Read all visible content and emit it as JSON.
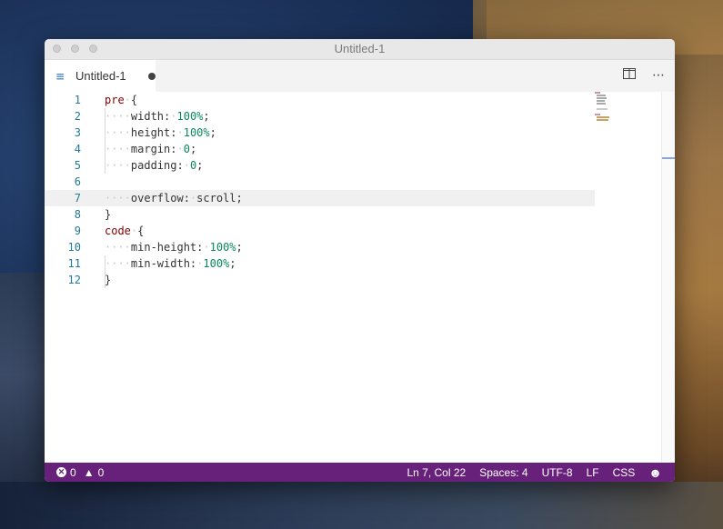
{
  "window": {
    "title": "Untitled-1"
  },
  "tab": {
    "label": "Untitled-1",
    "icon": "css-file-icon"
  },
  "editor": {
    "lines": [
      {
        "n": "1",
        "indent": "",
        "tokens": [
          [
            "sel",
            "pre"
          ],
          [
            "ws",
            "·"
          ],
          [
            "plain",
            "{"
          ]
        ]
      },
      {
        "n": "2",
        "indent": "····",
        "tokens": [
          [
            "prop",
            "width:"
          ],
          [
            "ws",
            "·"
          ],
          [
            "num",
            "100%"
          ],
          [
            "plain",
            ";"
          ]
        ]
      },
      {
        "n": "3",
        "indent": "····",
        "tokens": [
          [
            "prop",
            "height:"
          ],
          [
            "ws",
            "·"
          ],
          [
            "num",
            "100%"
          ],
          [
            "plain",
            ";"
          ]
        ]
      },
      {
        "n": "4",
        "indent": "····",
        "tokens": [
          [
            "prop",
            "margin:"
          ],
          [
            "ws",
            "·"
          ],
          [
            "num",
            "0"
          ],
          [
            "plain",
            ";"
          ]
        ]
      },
      {
        "n": "5",
        "indent": "····",
        "tokens": [
          [
            "prop",
            "padding:"
          ],
          [
            "ws",
            "·"
          ],
          [
            "num",
            "0"
          ],
          [
            "plain",
            ";"
          ]
        ]
      },
      {
        "n": "6",
        "indent": "",
        "tokens": []
      },
      {
        "n": "7",
        "indent": "····",
        "tokens": [
          [
            "prop",
            "overflow:"
          ],
          [
            "ws",
            "·"
          ],
          [
            "plain",
            "scroll;"
          ]
        ]
      },
      {
        "n": "8",
        "indent": "",
        "tokens": [
          [
            "plain",
            "}"
          ]
        ]
      },
      {
        "n": "9",
        "indent": "",
        "tokens": [
          [
            "sel",
            "code"
          ],
          [
            "ws",
            "·"
          ],
          [
            "plain",
            "{"
          ]
        ]
      },
      {
        "n": "10",
        "indent": "····",
        "tokens": [
          [
            "prop",
            "min-height:"
          ],
          [
            "ws",
            "·"
          ],
          [
            "num",
            "100%"
          ],
          [
            "plain",
            ";"
          ]
        ]
      },
      {
        "n": "11",
        "indent": "····",
        "tokens": [
          [
            "prop",
            "min-width:"
          ],
          [
            "ws",
            "·"
          ],
          [
            "num",
            "100%"
          ],
          [
            "plain",
            ";"
          ]
        ]
      },
      {
        "n": "12",
        "indent": "",
        "tokens": [
          [
            "plain",
            "}"
          ]
        ]
      }
    ],
    "current_line": 7
  },
  "status": {
    "errors": "0",
    "warnings": "0",
    "position": "Ln 7, Col 22",
    "spaces": "Spaces: 4",
    "encoding": "UTF-8",
    "eol": "LF",
    "language": "CSS",
    "feedback_icon": "smiley-icon"
  },
  "colors": {
    "statusbar": "#68217a",
    "selector": "#800000",
    "number": "#09885a",
    "line_number": "#237893"
  }
}
